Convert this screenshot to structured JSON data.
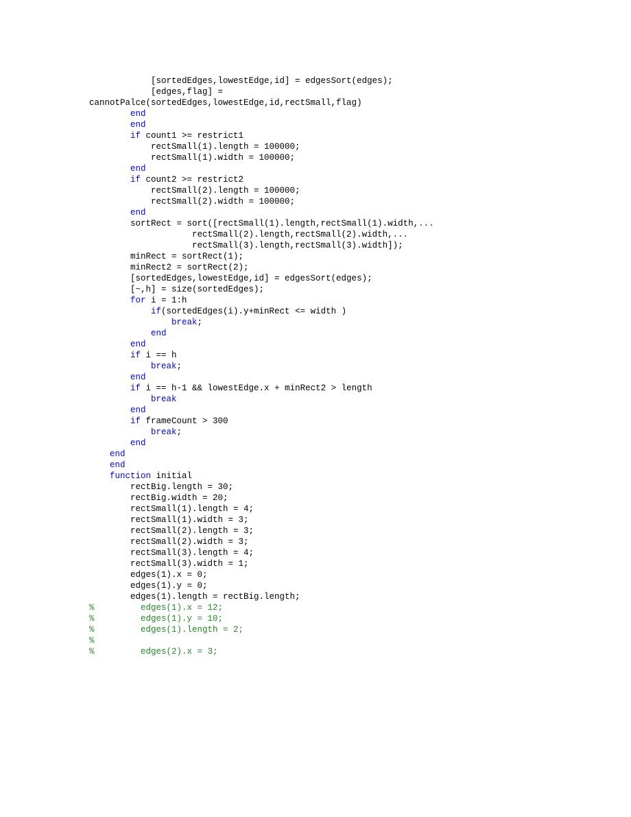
{
  "lines": [
    [
      {
        "t": "            [sortedEdges,lowestEdge,id] = edgesSort(edges);",
        "c": "txt"
      }
    ],
    [
      {
        "t": "            [edges,flag] = ",
        "c": "txt"
      }
    ],
    [
      {
        "t": "cannotPalce(sortedEdges,lowestEdge,id,rectSmall,flag)",
        "c": "txt"
      }
    ],
    [
      {
        "t": "        ",
        "c": "txt"
      },
      {
        "t": "end",
        "c": "kw"
      }
    ],
    [
      {
        "t": "        ",
        "c": "txt"
      },
      {
        "t": "end",
        "c": "kw"
      }
    ],
    [
      {
        "t": "        ",
        "c": "txt"
      },
      {
        "t": "if",
        "c": "kw"
      },
      {
        "t": " count1 >= restrict1",
        "c": "txt"
      }
    ],
    [
      {
        "t": "            rectSmall(1).length = 100000;",
        "c": "txt"
      }
    ],
    [
      {
        "t": "            rectSmall(1).width = 100000;",
        "c": "txt"
      }
    ],
    [
      {
        "t": "        ",
        "c": "txt"
      },
      {
        "t": "end",
        "c": "kw"
      }
    ],
    [
      {
        "t": "        ",
        "c": "txt"
      },
      {
        "t": "if",
        "c": "kw"
      },
      {
        "t": " count2 >= restrict2",
        "c": "txt"
      }
    ],
    [
      {
        "t": "            rectSmall(2).length = 100000;",
        "c": "txt"
      }
    ],
    [
      {
        "t": "            rectSmall(2).width = 100000;",
        "c": "txt"
      }
    ],
    [
      {
        "t": "        ",
        "c": "txt"
      },
      {
        "t": "end",
        "c": "kw"
      }
    ],
    [
      {
        "t": "        sortRect = sort([rectSmall(1).length,rectSmall(1).width,",
        "c": "txt"
      },
      {
        "t": "...",
        "c": "kw"
      }
    ],
    [
      {
        "t": "                    rectSmall(2).length,rectSmall(2).width,",
        "c": "txt"
      },
      {
        "t": "...",
        "c": "kw"
      }
    ],
    [
      {
        "t": "                    rectSmall(3).length,rectSmall(3).width]);",
        "c": "txt"
      }
    ],
    [
      {
        "t": "        minRect = sortRect(1);",
        "c": "txt"
      }
    ],
    [
      {
        "t": "        minRect2 = sortRect(2);",
        "c": "txt"
      }
    ],
    [
      {
        "t": "        [sortedEdges,lowestEdge,id] = edgesSort(edges);",
        "c": "txt"
      }
    ],
    [
      {
        "t": "        [~,h] = size(sortedEdges);",
        "c": "txt"
      }
    ],
    [
      {
        "t": "        ",
        "c": "txt"
      },
      {
        "t": "for",
        "c": "kw"
      },
      {
        "t": " i = 1:h",
        "c": "txt"
      }
    ],
    [
      {
        "t": "            ",
        "c": "txt"
      },
      {
        "t": "if",
        "c": "kw"
      },
      {
        "t": "(sortedEdges(i).y+minRect <= width )",
        "c": "txt"
      }
    ],
    [
      {
        "t": "                ",
        "c": "txt"
      },
      {
        "t": "break",
        "c": "kw"
      },
      {
        "t": ";",
        "c": "txt"
      }
    ],
    [
      {
        "t": "            ",
        "c": "txt"
      },
      {
        "t": "end",
        "c": "kw"
      }
    ],
    [
      {
        "t": "        ",
        "c": "txt"
      },
      {
        "t": "end",
        "c": "kw"
      }
    ],
    [
      {
        "t": "        ",
        "c": "txt"
      },
      {
        "t": "if",
        "c": "kw"
      },
      {
        "t": " i == h",
        "c": "txt"
      }
    ],
    [
      {
        "t": "            ",
        "c": "txt"
      },
      {
        "t": "break",
        "c": "kw"
      },
      {
        "t": ";",
        "c": "txt"
      }
    ],
    [
      {
        "t": "        ",
        "c": "txt"
      },
      {
        "t": "end",
        "c": "kw"
      }
    ],
    [
      {
        "t": "        ",
        "c": "txt"
      },
      {
        "t": "if",
        "c": "kw"
      },
      {
        "t": " i == h-1 && lowestEdge.x + minRect2 > length",
        "c": "txt"
      }
    ],
    [
      {
        "t": "            ",
        "c": "txt"
      },
      {
        "t": "break",
        "c": "kw"
      }
    ],
    [
      {
        "t": "        ",
        "c": "txt"
      },
      {
        "t": "end",
        "c": "kw"
      }
    ],
    [
      {
        "t": "        ",
        "c": "txt"
      },
      {
        "t": "if",
        "c": "kw"
      },
      {
        "t": " frameCount > 300",
        "c": "txt"
      }
    ],
    [
      {
        "t": "            ",
        "c": "txt"
      },
      {
        "t": "break",
        "c": "kw"
      },
      {
        "t": ";",
        "c": "txt"
      }
    ],
    [
      {
        "t": "        ",
        "c": "txt"
      },
      {
        "t": "end",
        "c": "kw"
      }
    ],
    [
      {
        "t": "    ",
        "c": "txt"
      },
      {
        "t": "end",
        "c": "kw"
      }
    ],
    [
      {
        "t": "    ",
        "c": "txt"
      },
      {
        "t": "end",
        "c": "kw"
      }
    ],
    [
      {
        "t": "    ",
        "c": "txt"
      },
      {
        "t": "function",
        "c": "kw"
      },
      {
        "t": " initial",
        "c": "txt"
      }
    ],
    [
      {
        "t": "        rectBig.length = 30;",
        "c": "txt"
      }
    ],
    [
      {
        "t": "        rectBig.width = 20;",
        "c": "txt"
      }
    ],
    [
      {
        "t": "        rectSmall(1).length = 4;",
        "c": "txt"
      }
    ],
    [
      {
        "t": "        rectSmall(1).width = 3;",
        "c": "txt"
      }
    ],
    [
      {
        "t": "        rectSmall(2).length = 3;",
        "c": "txt"
      }
    ],
    [
      {
        "t": "        rectSmall(2).width = 3;",
        "c": "txt"
      }
    ],
    [
      {
        "t": "        rectSmall(3).length = 4;",
        "c": "txt"
      }
    ],
    [
      {
        "t": "        rectSmall(3).width = 1;",
        "c": "txt"
      }
    ],
    [
      {
        "t": "        edges(1).x = 0;",
        "c": "txt"
      }
    ],
    [
      {
        "t": "        edges(1).y = 0;",
        "c": "txt"
      }
    ],
    [
      {
        "t": "        edges(1).length = rectBig.length;",
        "c": "txt"
      }
    ],
    [
      {
        "t": "",
        "c": "txt"
      }
    ],
    [
      {
        "t": "",
        "c": "txt"
      }
    ],
    [
      {
        "t": "",
        "c": "txt"
      }
    ],
    [
      {
        "t": "",
        "c": "txt"
      }
    ],
    [
      {
        "t": "%         edges(1).x = 12;",
        "c": "cm"
      }
    ],
    [
      {
        "t": "%         edges(1).y = 10;",
        "c": "cm"
      }
    ],
    [
      {
        "t": "%         edges(1).length = 2;",
        "c": "cm"
      }
    ],
    [
      {
        "t": "%",
        "c": "cm"
      }
    ],
    [
      {
        "t": "%         edges(2).x = 3;",
        "c": "cm"
      }
    ]
  ]
}
